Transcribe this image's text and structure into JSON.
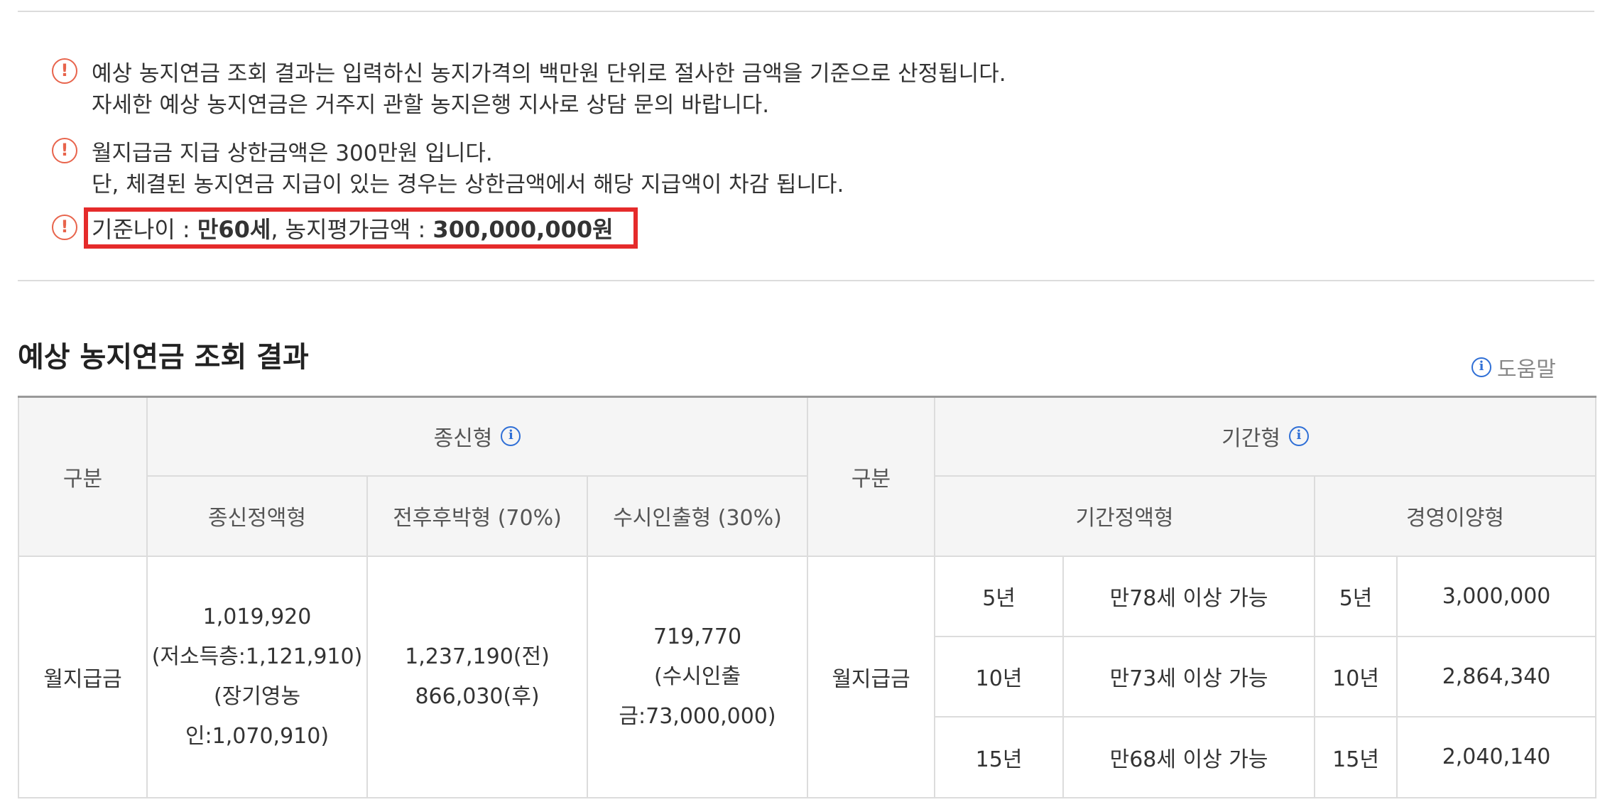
{
  "notices": [
    {
      "icon": "warning-icon",
      "line1": "예상 농지연금 조회 결과는 입력하신 농지가격의 백만원 단위로 절사한 금액을 기준으로 산정됩니다.",
      "line2": "자세한 예상 농지연금은 거주지 관할 농지은행 지사로 상담 문의 바랍니다."
    },
    {
      "icon": "warning-icon",
      "line1": "월지급금 지급 상한금액은 300만원 입니다.",
      "line2": "단, 체결된 농지연금 지급이 있는 경우는 상한금액에서 해당 지급액이 차감 됩니다."
    }
  ],
  "summary": {
    "age_label": "기준나이 : ",
    "age_value": "만60세",
    "separator": ", ",
    "price_label": "농지평가금액 : ",
    "price_value": "300,000,000원",
    "highlight_color": "#e52b2b"
  },
  "section_title": "예상 농지연금 조회 결과",
  "help_label": "도움말",
  "table": {
    "col_category": "구분",
    "lifetime_header": "종신형",
    "lifetime_types": [
      "종신정액형",
      "전후후박형 (70%)",
      "수시인출형 (30%)"
    ],
    "term_header": "기간형",
    "term_types": [
      "기간정액형",
      "경영이양형"
    ],
    "row_label": "월지급금",
    "lifetime_values": {
      "fixed": [
        "1,019,920",
        "(저소득층:1,121,910)",
        "(장기영농인:1,070,910)"
      ],
      "front_back": [
        "1,237,190(전)",
        "866,030(후)"
      ],
      "withdrawal": [
        "719,770",
        "(수시인출",
        "금:73,000,000)"
      ]
    },
    "term_rows": [
      {
        "years": "5년",
        "eligibility": "만78세 이상 가능",
        "transfer_years": "5년",
        "transfer_amount": "3,000,000"
      },
      {
        "years": "10년",
        "eligibility": "만73세 이상 가능",
        "transfer_years": "10년",
        "transfer_amount": "2,864,340"
      },
      {
        "years": "15년",
        "eligibility": "만68세 이상 가능",
        "transfer_years": "15년",
        "transfer_amount": "2,040,140"
      }
    ]
  },
  "colors": {
    "warning": "#e8644c",
    "info": "#2f6fd6",
    "header_bg": "#f5f5f5",
    "border": "#dcdcdc"
  }
}
